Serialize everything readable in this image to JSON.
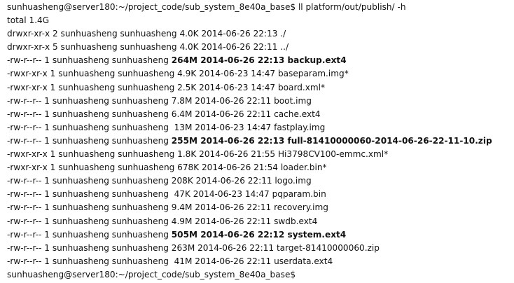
{
  "terminal": {
    "prompt_text": "sunhuasheng@server180:~/project_code/sub_system_8e40a_base$",
    "command_text": " ll platform/out/publish/ -h",
    "total_line": "total 1.4G",
    "entries": [
      {
        "prefix": "drwxr-xr-x 2 sunhuasheng sunhuasheng 4.0K 2014-06-26 22:13 ./",
        "bold_text": ""
      },
      {
        "prefix": "drwxr-xr-x 5 sunhuasheng sunhuasheng 4.0K 2014-06-26 22:11 ../",
        "bold_text": ""
      },
      {
        "prefix": "-rw-r--r-- 1 sunhuasheng sunhuasheng ",
        "bold_text": "264M 2014-06-26 22:13 backup.ext4"
      },
      {
        "prefix": "-rwxr-xr-x 1 sunhuasheng sunhuasheng 4.9K 2014-06-23 14:47 baseparam.img*",
        "bold_text": ""
      },
      {
        "prefix": "-rwxr-xr-x 1 sunhuasheng sunhuasheng 2.5K 2014-06-23 14:47 board.xml*",
        "bold_text": ""
      },
      {
        "prefix": "-rw-r--r-- 1 sunhuasheng sunhuasheng 7.8M 2014-06-26 22:11 boot.img",
        "bold_text": ""
      },
      {
        "prefix": "-rw-r--r-- 1 sunhuasheng sunhuasheng 6.4M 2014-06-26 22:11 cache.ext4",
        "bold_text": ""
      },
      {
        "prefix": "-rw-r--r-- 1 sunhuasheng sunhuasheng  13M 2014-06-23 14:47 fastplay.img",
        "bold_text": ""
      },
      {
        "prefix": "-rw-r--r-- 1 sunhuasheng sunhuasheng ",
        "bold_text": "255M 2014-06-26 22:13 full-81410000060-2014-06-26-22-11-10.zip"
      },
      {
        "prefix": "-rwxr-xr-x 1 sunhuasheng sunhuasheng 1.8K 2014-06-26 21:55 Hi3798CV100-emmc.xml*",
        "bold_text": ""
      },
      {
        "prefix": "-rwxr-xr-x 1 sunhuasheng sunhuasheng 678K 2014-06-26 21:54 loader.bin*",
        "bold_text": ""
      },
      {
        "prefix": "-rw-r--r-- 1 sunhuasheng sunhuasheng 208K 2014-06-26 22:11 logo.img",
        "bold_text": ""
      },
      {
        "prefix": "-rw-r--r-- 1 sunhuasheng sunhuasheng  47K 2014-06-23 14:47 pqparam.bin",
        "bold_text": ""
      },
      {
        "prefix": "-rw-r--r-- 1 sunhuasheng sunhuasheng 9.4M 2014-06-26 22:11 recovery.img",
        "bold_text": ""
      },
      {
        "prefix": "-rw-r--r-- 1 sunhuasheng sunhuasheng 4.9M 2014-06-26 22:11 swdb.ext4",
        "bold_text": ""
      },
      {
        "prefix": "-rw-r--r-- 1 sunhuasheng sunhuasheng ",
        "bold_text": "505M 2014-06-26 22:12 system.ext4"
      },
      {
        "prefix": "-rw-r--r-- 1 sunhuasheng sunhuasheng 263M 2014-06-26 22:11 target-81410000060.zip",
        "bold_text": ""
      },
      {
        "prefix": "-rw-r--r-- 1 sunhuasheng sunhuasheng  41M 2014-06-26 22:11 userdata.ext4",
        "bold_text": ""
      }
    ],
    "final_prompt": "sunhuasheng@server180:~/project_code/sub_system_8e40a_base$"
  }
}
